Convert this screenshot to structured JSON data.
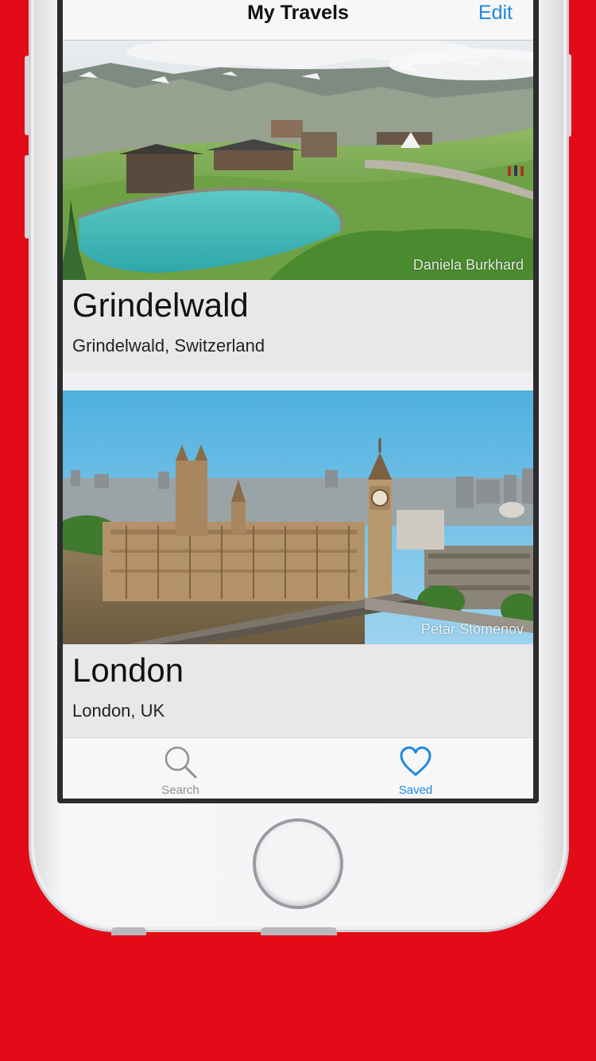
{
  "navbar": {
    "title": "My Travels",
    "edit_label": "Edit"
  },
  "places": [
    {
      "name": "Grindelwald",
      "location": "Grindelwald, Switzerland",
      "photo_credit": "Daniela Burkhard"
    },
    {
      "name": "London",
      "location": "London, UK",
      "photo_credit": "Petar Stomenov"
    }
  ],
  "tabbar": {
    "search_label": "Search",
    "saved_label": "Saved",
    "search_icon": "search-icon",
    "saved_icon": "heart-icon"
  },
  "colors": {
    "background": "#e30b17",
    "accent": "#1e88e5",
    "inactive_tab": "#8e8e93"
  }
}
